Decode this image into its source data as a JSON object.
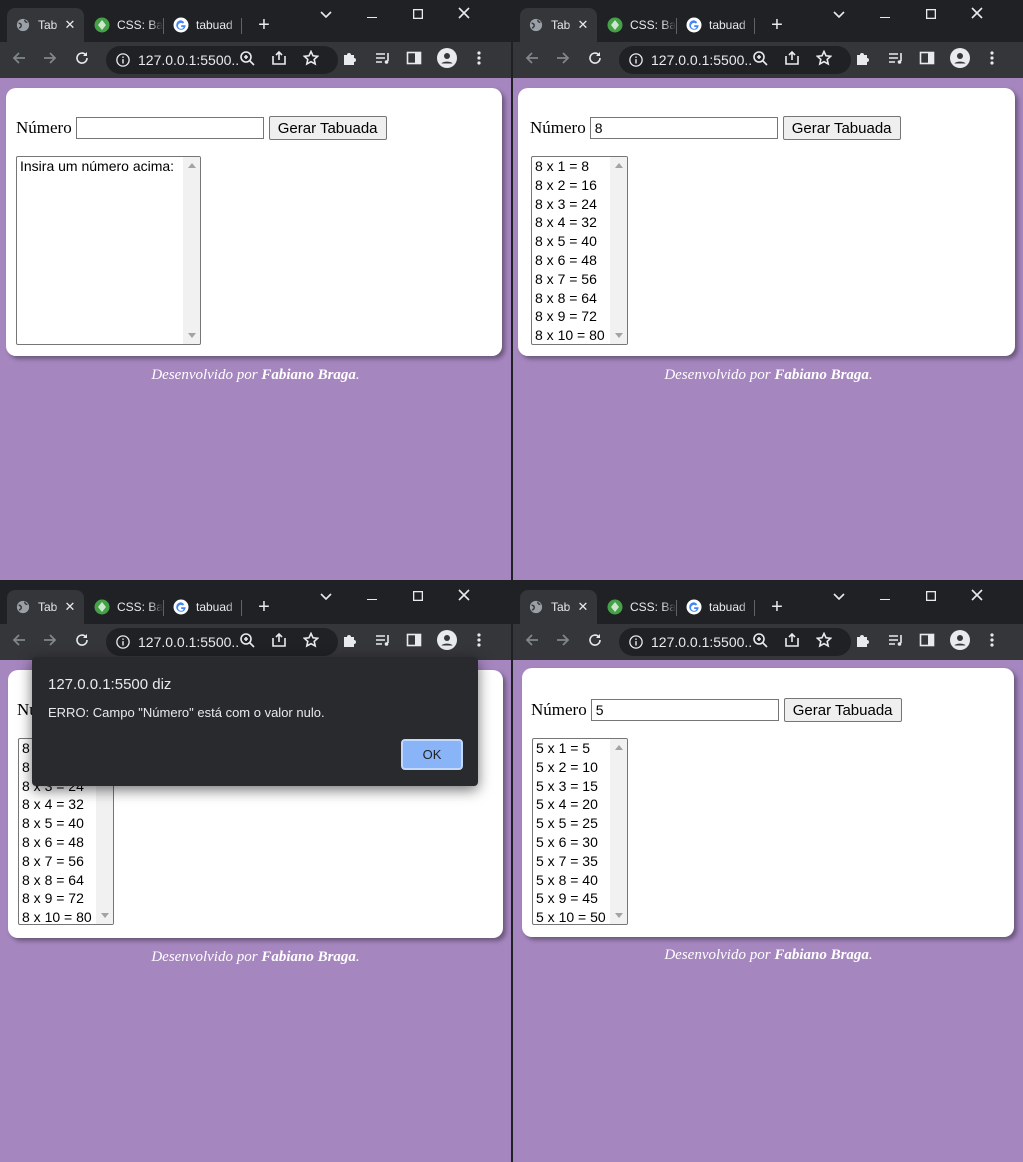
{
  "colors": {
    "page_bg": "#a586bf",
    "chrome_dark": "#202124",
    "chrome_toolbar": "#35363a",
    "alert_bg": "#292a2d",
    "ok_button": "#8ab4f8"
  },
  "browser": {
    "tabs": [
      {
        "title": "Tab",
        "icon": "globe-icon",
        "active": true
      },
      {
        "title": "CSS: Ba",
        "icon": "codepen-leaf-icon",
        "active": false
      },
      {
        "title": "tabuad",
        "icon": "google-icon",
        "active": false
      }
    ],
    "url": "127.0.0.1:5500..."
  },
  "app": {
    "label": "Número",
    "button": "Gerar Tabuada",
    "footer_prefix": "Desenvolvido por ",
    "footer_author": "Fabiano Braga",
    "footer_suffix": "."
  },
  "screens": [
    {
      "input_value": "",
      "items": [
        "Insira um número acima:"
      ]
    },
    {
      "input_value": "8",
      "items": [
        "8 x 1 = 8",
        "8 x 2 = 16",
        "8 x 3 = 24",
        "8 x 4 = 32",
        "8 x 5 = 40",
        "8 x 6 = 48",
        "8 x 7 = 56",
        "8 x 8 = 64",
        "8 x 9 = 72",
        "8 x 10 = 80"
      ]
    },
    {
      "input_value": "",
      "items": [
        "8 x 1 = 8",
        "8 x 2 = 16",
        "8 x 3 = 24",
        "8 x 4 = 32",
        "8 x 5 = 40",
        "8 x 6 = 48",
        "8 x 7 = 56",
        "8 x 8 = 64",
        "8 x 9 = 72",
        "8 x 10 = 80"
      ]
    },
    {
      "input_value": "5",
      "items": [
        "5 x 1 = 5",
        "5 x 2 = 10",
        "5 x 3 = 15",
        "5 x 4 = 20",
        "5 x 5 = 25",
        "5 x 6 = 30",
        "5 x 7 = 35",
        "5 x 8 = 40",
        "5 x 9 = 45",
        "5 x 10 = 50"
      ]
    }
  ],
  "alert": {
    "title": "127.0.0.1:5500 diz",
    "message": "ERRO: Campo \"Número\" está com o valor nulo.",
    "ok": "OK"
  }
}
